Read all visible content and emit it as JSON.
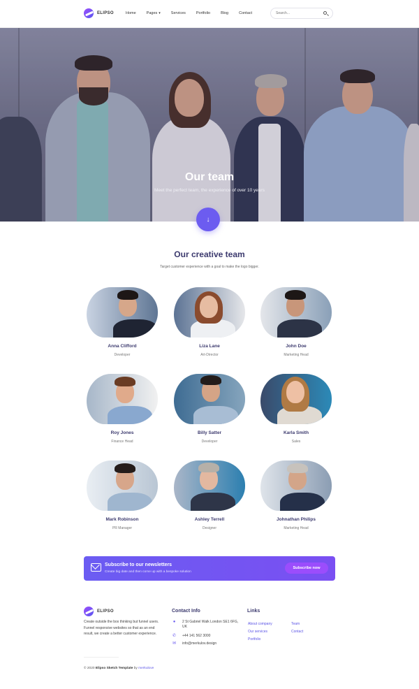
{
  "header": {
    "brand": "ELIPSO",
    "nav": [
      {
        "label": "Home"
      },
      {
        "label": "Pages",
        "has_dropdown": true
      },
      {
        "label": "Services"
      },
      {
        "label": "Portfolio"
      },
      {
        "label": "Blog"
      },
      {
        "label": "Contact"
      }
    ],
    "search_placeholder": "Search..."
  },
  "hero": {
    "title": "Our team",
    "subtitle": "Meet the perfect team, the experience of over 10 years",
    "scroll_icon": "arrow-down-icon"
  },
  "team": {
    "title": "Our creative team",
    "subtitle": "Target customer experience with a goal to make the logo bigger.",
    "members": [
      {
        "name": "Anna Clifford",
        "role": "Developer"
      },
      {
        "name": "Liza Lane",
        "role": "Art-Director"
      },
      {
        "name": "John Doe",
        "role": "Marketing Head"
      },
      {
        "name": "Roy Jones",
        "role": "Finance Head"
      },
      {
        "name": "Billy Satter",
        "role": "Developer"
      },
      {
        "name": "Karla Smith",
        "role": "Sales"
      },
      {
        "name": "Mark Robinson",
        "role": "PR Manager"
      },
      {
        "name": "Ashley Terrell",
        "role": "Designer"
      },
      {
        "name": "Johnathan Philips",
        "role": "Marketing Head"
      }
    ]
  },
  "newsletter": {
    "title": "Subscribe to our newsletters",
    "subtitle": "Create big date and then come up with a bespoke solution",
    "button": "Subscribe now"
  },
  "footer": {
    "brand": "ELIPSO",
    "about": "Create outside the box thinking but funnel users. Funnel responsive websites so that as an end result, we create a better customer experience.",
    "contact_title": "Contact Info",
    "address": "2 St Gabriel Walk London SE1 6FG, UK",
    "phone": "+44 141 562 3000",
    "email": "info@merkulov.design",
    "links_title": "Links",
    "links_col1": [
      "About company",
      "Our services",
      "Portfolio"
    ],
    "links_col2": [
      "Team",
      "Contact"
    ],
    "copyright_prefix": "© 2020",
    "copyright_name": "Elipso Sketch Template",
    "copyright_by": "by",
    "copyright_author": "merkulove"
  },
  "colors": {
    "accent": "#6c5cf0",
    "accent_2": "#9b4dfc",
    "heading": "#3c3a6e"
  }
}
